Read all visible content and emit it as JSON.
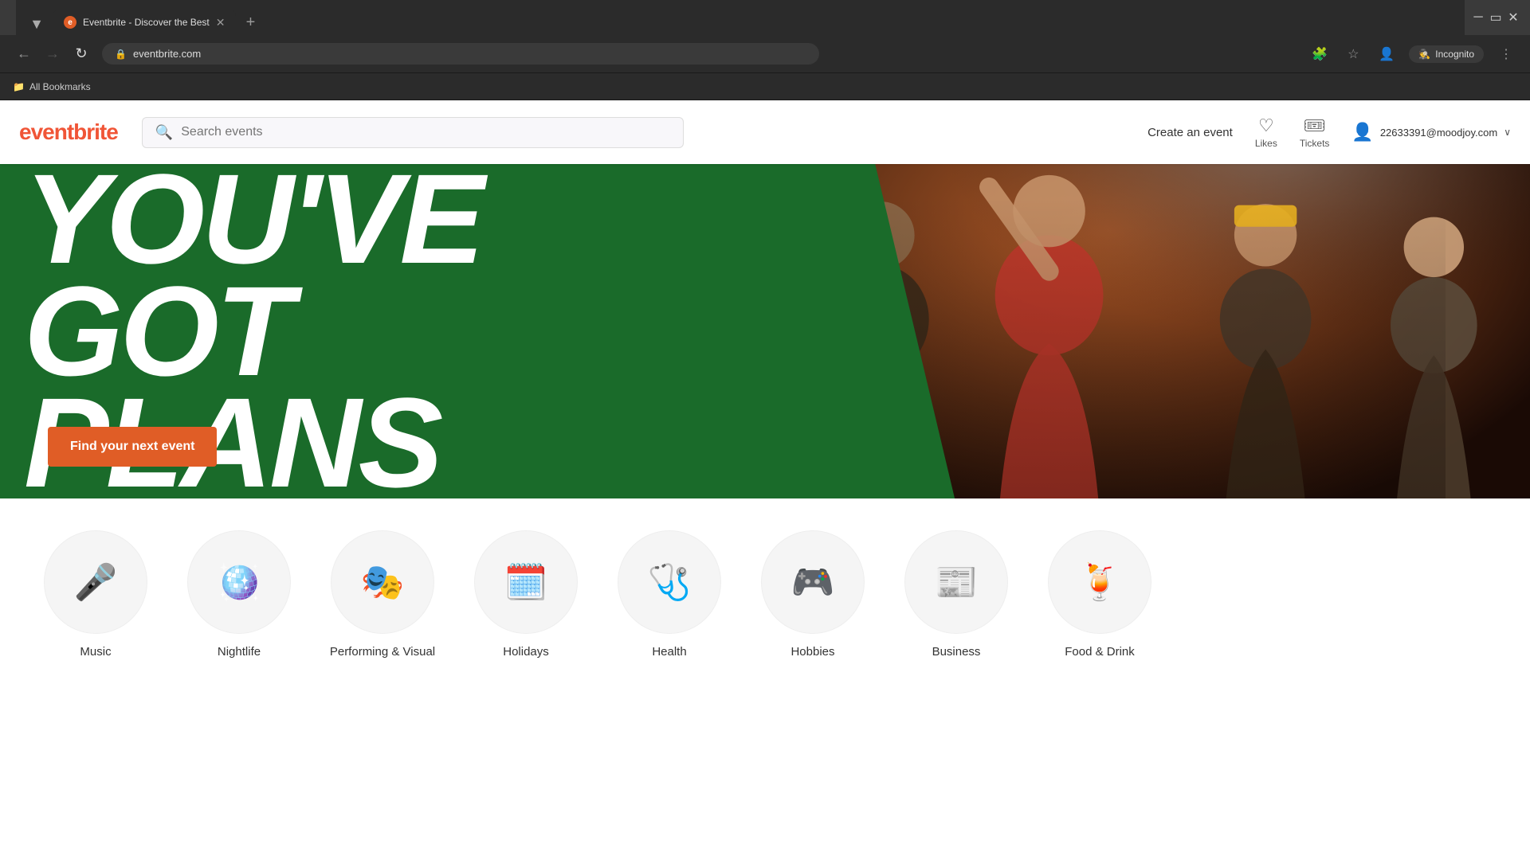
{
  "browser": {
    "tab_label": "Eventbrite - Discover the Best",
    "tab_favicon": "e",
    "url": "eventbrite.com",
    "incognito_label": "Incognito",
    "bookmarks_label": "All Bookmarks"
  },
  "header": {
    "logo_text": "eventbrite",
    "search_placeholder": "Search events",
    "create_event": "Create an event",
    "likes_label": "Likes",
    "tickets_label": "Tickets",
    "user_email": "22633391@moodjoy.com"
  },
  "hero": {
    "title_line1": "YOU'VE",
    "title_line2": "GOT",
    "title_line3": "PLANS",
    "cta_label": "Find your next event"
  },
  "categories": [
    {
      "id": "music",
      "label": "Music",
      "icon": "🎤"
    },
    {
      "id": "nightlife",
      "label": "Nightlife",
      "icon": "🪩"
    },
    {
      "id": "performing-visual",
      "label": "Performing & Visual",
      "icon": "🎭"
    },
    {
      "id": "holidays",
      "label": "Holidays",
      "icon": "🗓️"
    },
    {
      "id": "health",
      "label": "Health",
      "icon": "🩺"
    },
    {
      "id": "hobbies",
      "label": "Hobbies",
      "icon": "🎮"
    },
    {
      "id": "business",
      "label": "Business",
      "icon": "📰"
    },
    {
      "id": "food-drink",
      "label": "Food & Drink",
      "icon": "🍹"
    }
  ],
  "icons": {
    "back": "←",
    "forward": "→",
    "refresh": "↻",
    "lock": "🔒",
    "extensions": "🧩",
    "bookmark": "☆",
    "profile": "👤",
    "menu": "⋮",
    "close": "✕",
    "new_tab": "+",
    "incognito": "🕵️",
    "folder": "📁",
    "heart": "♡",
    "ticket": "🎟",
    "user": "👤",
    "chevron_down": "∨",
    "search": "🔍"
  }
}
